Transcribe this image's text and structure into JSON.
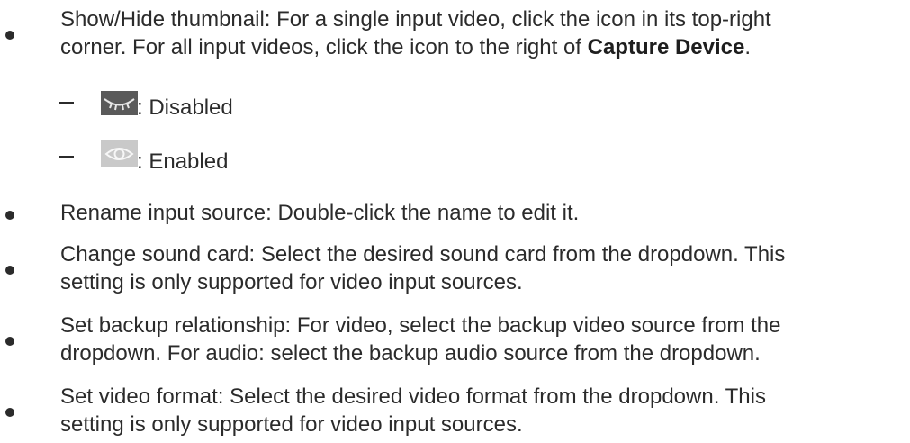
{
  "items": [
    {
      "line1": "Show/Hide thumbnail: For a single input video, click the icon in its top-right",
      "line2_prefix": "corner. For all input videos, click the icon to the right of ",
      "line2_bold": "Capture Device",
      "line2_suffix": "."
    },
    {
      "line1": "Rename input source: Double-click the name to edit it."
    },
    {
      "line1": "Change sound card: Select the desired sound card from the dropdown. This",
      "line2": "setting is only supported for video input sources."
    },
    {
      "line1": "Set backup relationship: For video, select the backup video source from the",
      "line2": "dropdown. For audio: select the backup audio source from the dropdown."
    },
    {
      "line1": "Set video format: Select the desired video format from the dropdown. This",
      "line2": "setting is only supported for video input sources."
    }
  ],
  "subitems": [
    {
      "icon": "eye-closed-icon",
      "label": ": Disabled"
    },
    {
      "icon": "eye-open-icon",
      "label": ": Enabled"
    }
  ],
  "colors": {
    "text": "#2b2b2b",
    "disabled_icon_bg": "#5a5a5a",
    "enabled_icon_bg": "#c9c9c9"
  }
}
